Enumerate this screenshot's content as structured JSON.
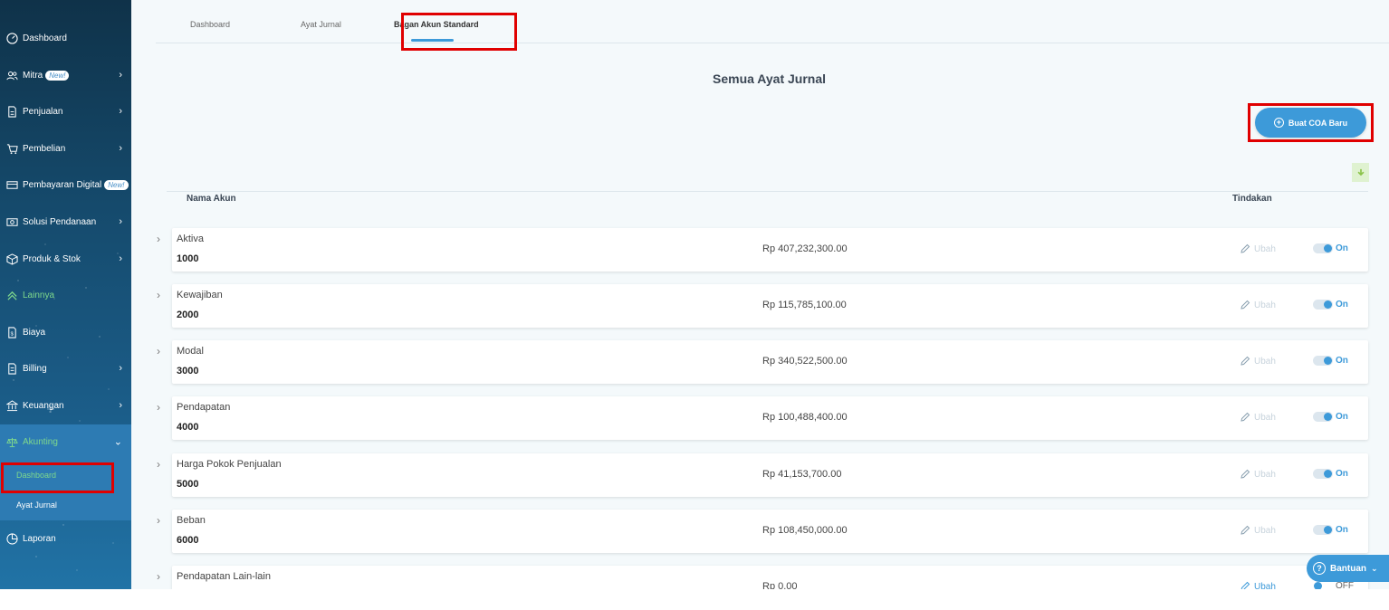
{
  "sidebar": {
    "items": [
      {
        "label": "Dashboard",
        "icon": "dashboard-icon"
      },
      {
        "label": "Mitra",
        "badge": "New!",
        "icon": "users-icon"
      },
      {
        "label": "Penjualan",
        "icon": "document-icon"
      },
      {
        "label": "Pembelian",
        "icon": "cart-icon"
      },
      {
        "label": "Pembayaran Digital",
        "badge": "New!",
        "icon": "card-icon"
      },
      {
        "label": "Solusi Pendanaan",
        "icon": "money-icon"
      },
      {
        "label": "Produk & Stok",
        "icon": "box-icon"
      },
      {
        "label": "Lainnya",
        "icon": "chevrons-up-icon"
      },
      {
        "label": "Biaya",
        "icon": "receipt-icon"
      },
      {
        "label": "Billing",
        "icon": "bill-icon"
      },
      {
        "label": "Keuangan",
        "icon": "bank-icon"
      },
      {
        "label": "Akunting",
        "icon": "scale-icon"
      },
      {
        "label": "Laporan",
        "icon": "pie-chart-icon"
      }
    ],
    "akunting_sub": [
      {
        "label": "Dashboard"
      },
      {
        "label": "Ayat Jurnal"
      }
    ]
  },
  "tabs": [
    {
      "label": "Dashboard"
    },
    {
      "label": "Ayat Jurnal"
    },
    {
      "label": "Bagan Akun Standard"
    }
  ],
  "page_title": "Semua Ayat Jurnal",
  "create_button": "Buat COA Baru",
  "table": {
    "col_name": "Nama Akun",
    "col_action": "Tindakan",
    "rows": [
      {
        "name": "Aktiva",
        "code": "1000",
        "amount": "Rp 407,232,300.00",
        "edit": "Ubah",
        "status": "On"
      },
      {
        "name": "Kewajiban",
        "code": "2000",
        "amount": "Rp 115,785,100.00",
        "edit": "Ubah",
        "status": "On"
      },
      {
        "name": "Modal",
        "code": "3000",
        "amount": "Rp 340,522,500.00",
        "edit": "Ubah",
        "status": "On"
      },
      {
        "name": "Pendapatan",
        "code": "4000",
        "amount": "Rp 100,488,400.00",
        "edit": "Ubah",
        "status": "On"
      },
      {
        "name": "Harga Pokok Penjualan",
        "code": "5000",
        "amount": "Rp 41,153,700.00",
        "edit": "Ubah",
        "status": "On"
      },
      {
        "name": "Beban",
        "code": "6000",
        "amount": "Rp 108,450,000.00",
        "edit": "Ubah",
        "status": "On"
      },
      {
        "name": "Pendapatan Lain-lain",
        "code": "",
        "amount": "Rp 0.00",
        "edit": "Ubah",
        "status": "OFF"
      }
    ]
  },
  "help_button": "Bantuan",
  "colors": {
    "accent": "#3d9ad9",
    "highlight": "#e00000",
    "sidebar_active": "#7fd98c"
  }
}
